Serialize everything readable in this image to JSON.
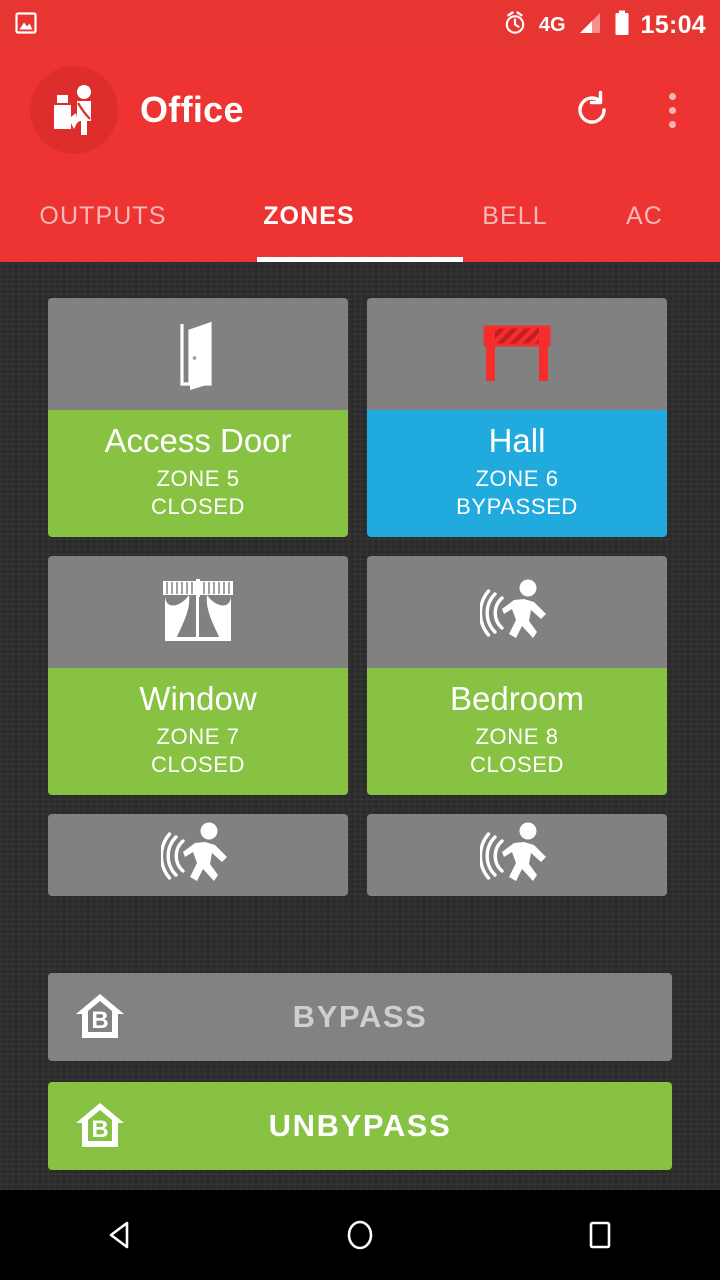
{
  "status_bar": {
    "image_icon": "image-icon",
    "alarm_icon": "alarm-clock-icon",
    "network": "4G",
    "signal_icon": "signal-icon",
    "battery_icon": "battery-icon",
    "time": "15:04"
  },
  "app_bar": {
    "avatar_icon": "family-avatar-icon",
    "title": "Office",
    "refresh_icon": "refresh-icon",
    "overflow_icon": "overflow-menu-icon"
  },
  "tabs": [
    {
      "label": "OUTPUTS",
      "active": false
    },
    {
      "label": "ZONES",
      "active": true
    },
    {
      "label": "BELL",
      "active": false
    },
    {
      "label": "AC",
      "active": false
    }
  ],
  "zones": [
    {
      "name": "Access Door",
      "zone": "ZONE 5",
      "state": "CLOSED",
      "state_color": "#87c242",
      "icon": "open-door-icon"
    },
    {
      "name": "Hall",
      "zone": "ZONE 6",
      "state": "BYPASSED",
      "state_color": "#21aade",
      "icon": "barrier-icon"
    },
    {
      "name": "Window",
      "zone": "ZONE 7",
      "state": "CLOSED",
      "state_color": "#87c242",
      "icon": "curtains-icon"
    },
    {
      "name": "Bedroom",
      "zone": "ZONE 8",
      "state": "CLOSED",
      "state_color": "#87c242",
      "icon": "motion-sensor-icon"
    },
    {
      "name": "",
      "zone": "",
      "state": "",
      "state_color": "#818181",
      "icon": "motion-sensor-icon"
    },
    {
      "name": "",
      "zone": "",
      "state": "",
      "state_color": "#818181",
      "icon": "motion-sensor-icon"
    }
  ],
  "actions": {
    "bypass_label": "BYPASS",
    "bypass_icon": "house-bypass-icon",
    "unbypass_label": "UNBYPASS",
    "unbypass_icon": "house-bypass-icon"
  },
  "nav_bar": {
    "back_icon": "back-triangle-icon",
    "home_icon": "home-circle-icon",
    "recents_icon": "recents-square-icon"
  },
  "colors": {
    "primary": "#ee3432",
    "status_bar": "#e73632",
    "green": "#87c242",
    "blue": "#21aade",
    "gray": "#818181",
    "background": "#2f2f2f",
    "red_icon": "#f52d2d"
  }
}
